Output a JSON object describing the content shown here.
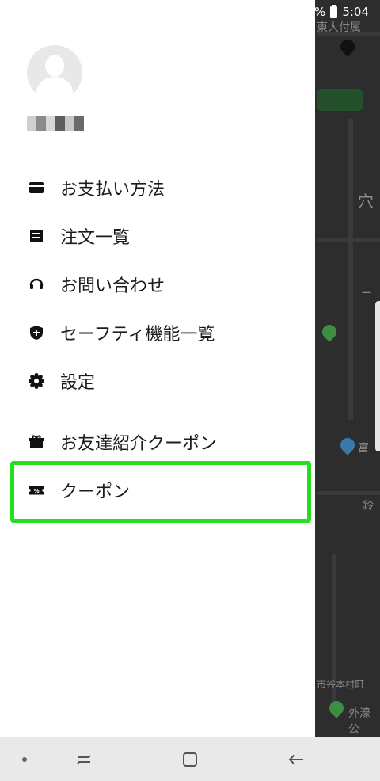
{
  "status_bar": {
    "battery_label": "%",
    "time": "5:04"
  },
  "map": {
    "labels": [
      "東大付属",
      "穴",
      "ー",
      "富",
      "鈴",
      "市谷本村町",
      "外濠公"
    ]
  },
  "profile": {
    "avatar_icon": "person-icon",
    "username_censored": true
  },
  "menu": {
    "items": [
      {
        "label": "お支払い方法",
        "icon": "wallet-icon"
      },
      {
        "label": "注文一覧",
        "icon": "receipt-icon"
      },
      {
        "label": "お問い合わせ",
        "icon": "headset-icon"
      },
      {
        "label": "セーフティ機能一覧",
        "icon": "shield-icon"
      },
      {
        "label": "設定",
        "icon": "gear-icon"
      },
      {
        "label": "お友達紹介クーポン",
        "icon": "gift-icon"
      },
      {
        "label": "クーポン",
        "icon": "coupon-icon"
      }
    ]
  },
  "colors": {
    "highlight": "#23e01a",
    "drawer_bg": "#ffffff",
    "map_bg": "#2d2d2d"
  },
  "navigation": {
    "buttons": [
      "recent-apps-icon",
      "home-icon",
      "back-icon"
    ]
  }
}
